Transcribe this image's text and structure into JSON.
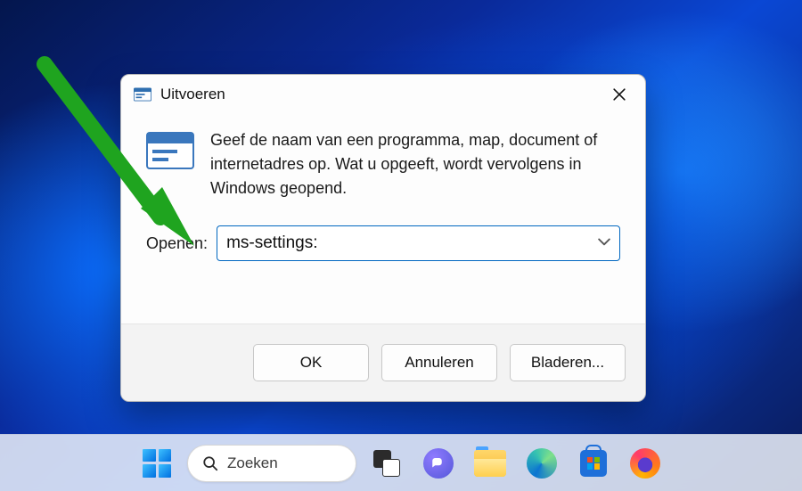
{
  "dialog": {
    "title": "Uitvoeren",
    "description": "Geef de naam van een programma, map, document of internetadres op. Wat u opgeeft, wordt vervolgens in Windows geopend.",
    "input_label": "Openen:",
    "input_value": "ms-settings:",
    "buttons": {
      "ok": "OK",
      "cancel": "Annuleren",
      "browse": "Bladeren..."
    }
  },
  "taskbar": {
    "search_label": "Zoeken",
    "items": [
      "start",
      "search",
      "task-view",
      "chat",
      "file-explorer",
      "edge",
      "microsoft-store",
      "firefox"
    ]
  },
  "annotation": {
    "arrow_color": "#1fa41f"
  }
}
